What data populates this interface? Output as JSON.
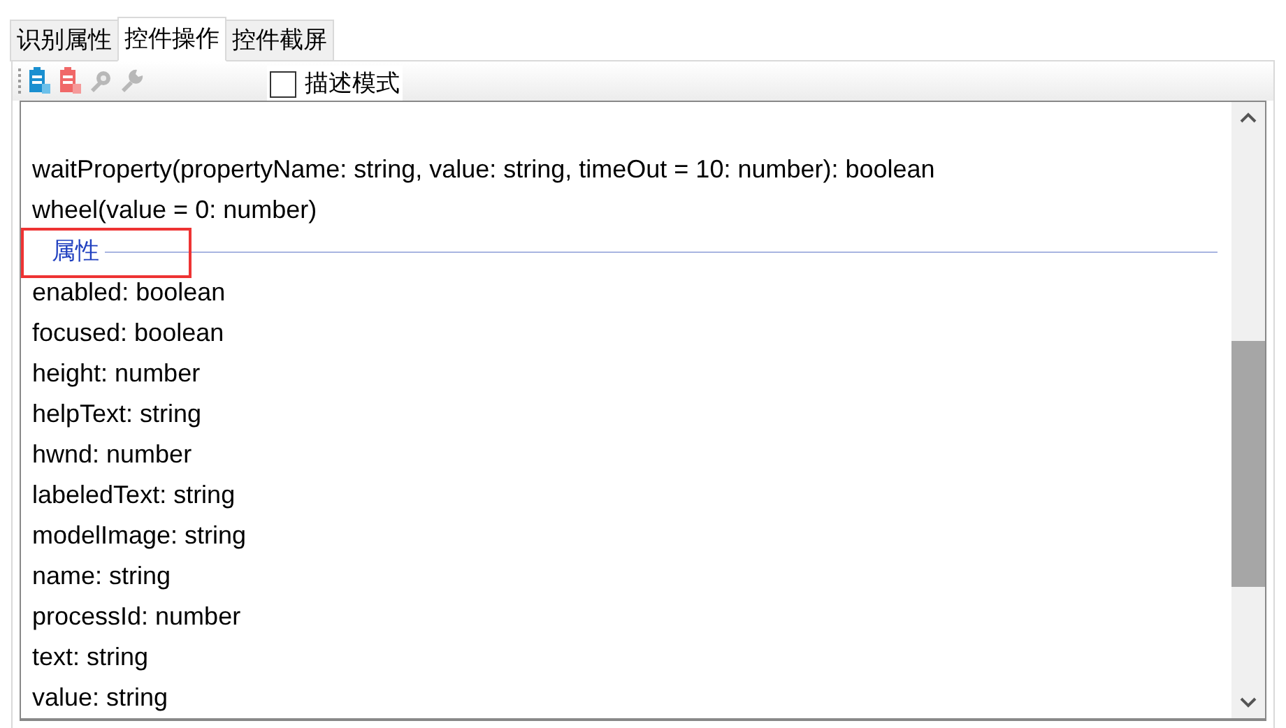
{
  "tabs": [
    {
      "label": "识别属性",
      "selected": false
    },
    {
      "label": "控件操作",
      "selected": true
    },
    {
      "label": "控件截屏",
      "selected": false
    }
  ],
  "toolbar": {
    "describe_mode": {
      "label": "描述模式",
      "checked": false
    }
  },
  "listing": {
    "items": [
      {
        "kind": "line",
        "text": "waitProperty(propertyName: string, value: string, timeOut = 10: number): boolean"
      },
      {
        "kind": "line",
        "text": "wheel(value = 0: number)"
      },
      {
        "kind": "section",
        "text": "属性",
        "highlighted": true
      },
      {
        "kind": "line",
        "text": "enabled: boolean"
      },
      {
        "kind": "line",
        "text": "focused: boolean"
      },
      {
        "kind": "line",
        "text": "height: number"
      },
      {
        "kind": "line",
        "text": "helpText: string"
      },
      {
        "kind": "line",
        "text": "hwnd: number"
      },
      {
        "kind": "line",
        "text": "labeledText: string"
      },
      {
        "kind": "line",
        "text": "modelImage: string"
      },
      {
        "kind": "line",
        "text": "name: string"
      },
      {
        "kind": "line",
        "text": "processId: number"
      },
      {
        "kind": "line",
        "text": "text: string"
      },
      {
        "kind": "line",
        "text": "value: string"
      }
    ]
  }
}
